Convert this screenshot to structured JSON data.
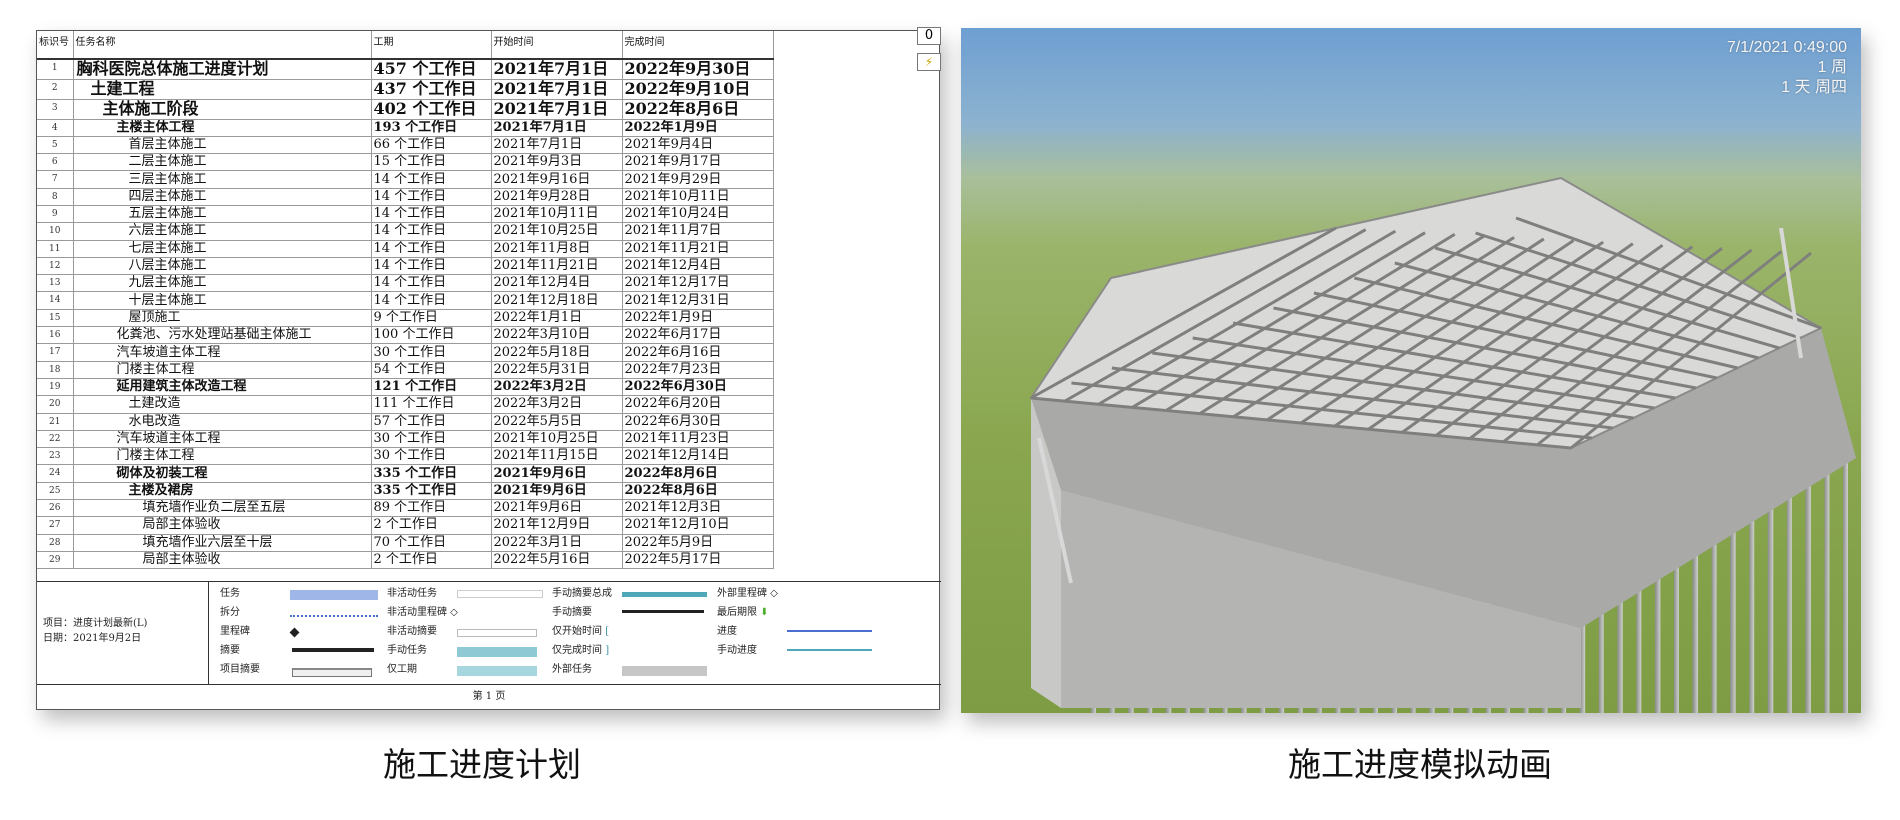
{
  "schedule": {
    "columns": {
      "id": "标识号",
      "name": "任务名称",
      "duration": "工期",
      "start": "开始时间",
      "finish": "完成时间"
    },
    "rows": [
      {
        "id": "1",
        "name": "胸科医院总体施工进度计划",
        "duration": "457 个工作日",
        "start": "2021年7月1日",
        "finish": "2022年9月30日"
      },
      {
        "id": "2",
        "name": "土建工程",
        "duration": "437 个工作日",
        "start": "2021年7月1日",
        "finish": "2022年9月10日"
      },
      {
        "id": "3",
        "name": "主体施工阶段",
        "duration": "402 个工作日",
        "start": "2021年7月1日",
        "finish": "2022年8月6日"
      },
      {
        "id": "4",
        "name": "主楼主体工程",
        "duration": "193 个工作日",
        "start": "2021年7月1日",
        "finish": "2022年1月9日"
      },
      {
        "id": "5",
        "name": "首层主体施工",
        "duration": "66 个工作日",
        "start": "2021年7月1日",
        "finish": "2021年9月4日"
      },
      {
        "id": "6",
        "name": "二层主体施工",
        "duration": "15 个工作日",
        "start": "2021年9月3日",
        "finish": "2021年9月17日"
      },
      {
        "id": "7",
        "name": "三层主体施工",
        "duration": "14 个工作日",
        "start": "2021年9月16日",
        "finish": "2021年9月29日"
      },
      {
        "id": "8",
        "name": "四层主体施工",
        "duration": "14 个工作日",
        "start": "2021年9月28日",
        "finish": "2021年10月11日"
      },
      {
        "id": "9",
        "name": "五层主体施工",
        "duration": "14 个工作日",
        "start": "2021年10月11日",
        "finish": "2021年10月24日"
      },
      {
        "id": "10",
        "name": "六层主体施工",
        "duration": "14 个工作日",
        "start": "2021年10月25日",
        "finish": "2021年11月7日"
      },
      {
        "id": "11",
        "name": "七层主体施工",
        "duration": "14 个工作日",
        "start": "2021年11月8日",
        "finish": "2021年11月21日"
      },
      {
        "id": "12",
        "name": "八层主体施工",
        "duration": "14 个工作日",
        "start": "2021年11月21日",
        "finish": "2021年12月4日"
      },
      {
        "id": "13",
        "name": "九层主体施工",
        "duration": "14 个工作日",
        "start": "2021年12月4日",
        "finish": "2021年12月17日"
      },
      {
        "id": "14",
        "name": "十层主体施工",
        "duration": "14 个工作日",
        "start": "2021年12月18日",
        "finish": "2021年12月31日"
      },
      {
        "id": "15",
        "name": "屋顶施工",
        "duration": "9 个工作日",
        "start": "2022年1月1日",
        "finish": "2022年1月9日"
      },
      {
        "id": "16",
        "name": "化粪池、污水处理站基础主体施工",
        "duration": "100 个工作日",
        "start": "2022年3月10日",
        "finish": "2022年6月17日"
      },
      {
        "id": "17",
        "name": "汽车坡道主体工程",
        "duration": "30 个工作日",
        "start": "2022年5月18日",
        "finish": "2022年6月16日"
      },
      {
        "id": "18",
        "name": "门楼主体工程",
        "duration": "54 个工作日",
        "start": "2022年5月31日",
        "finish": "2022年7月23日"
      },
      {
        "id": "19",
        "name": "延用建筑主体改造工程",
        "duration": "121 个工作日",
        "start": "2022年3月2日",
        "finish": "2022年6月30日"
      },
      {
        "id": "20",
        "name": "土建改造",
        "duration": "111 个工作日",
        "start": "2022年3月2日",
        "finish": "2022年6月20日"
      },
      {
        "id": "21",
        "name": "水电改造",
        "duration": "57 个工作日",
        "start": "2022年5月5日",
        "finish": "2022年6月30日"
      },
      {
        "id": "22",
        "name": "汽车坡道主体工程",
        "duration": "30 个工作日",
        "start": "2021年10月25日",
        "finish": "2021年11月23日"
      },
      {
        "id": "23",
        "name": "门楼主体工程",
        "duration": "30 个工作日",
        "start": "2021年11月15日",
        "finish": "2021年12月14日"
      },
      {
        "id": "24",
        "name": "砌体及初装工程",
        "duration": "335 个工作日",
        "start": "2021年9月6日",
        "finish": "2022年8月6日"
      },
      {
        "id": "25",
        "name": "主楼及裙房",
        "duration": "335 个工作日",
        "start": "2021年9月6日",
        "finish": "2022年8月6日"
      },
      {
        "id": "26",
        "name": "填充墙作业负二层至五层",
        "duration": "89 个工作日",
        "start": "2021年9月6日",
        "finish": "2021年12月3日"
      },
      {
        "id": "27",
        "name": "局部主体验收",
        "duration": "2 个工作日",
        "start": "2021年12月9日",
        "finish": "2021年12月10日"
      },
      {
        "id": "28",
        "name": "填充墙作业六层至十层",
        "duration": "70 个工作日",
        "start": "2022年3月1日",
        "finish": "2022年5月9日"
      },
      {
        "id": "29",
        "name": "局部主体验收",
        "duration": "2 个工作日",
        "start": "2022年5月16日",
        "finish": "2022年5月17日"
      }
    ],
    "corner_number": "0",
    "corner_icon": "⚡"
  },
  "legend": {
    "project": "项目：进度计划最新(L)",
    "date": "日期：2021年9月2日",
    "col1": [
      "任务",
      "拆分",
      "里程碑",
      "摘要",
      "项目摘要"
    ],
    "col2": [
      "非活动任务",
      "非活动里程碑",
      "非活动摘要",
      "手动任务",
      "仅工期"
    ],
    "col3": [
      "手动摘要总成",
      "手动摘要",
      "仅开始时间",
      "仅完成时间",
      "外部任务"
    ],
    "col4": [
      "外部里程碑",
      "最后期限",
      "进度",
      "手动进度"
    ]
  },
  "page_footer": "第 1 页",
  "simulation": {
    "datetime": "7/1/2021 0:49:00",
    "week": "1 周",
    "day": "1 天 周四"
  },
  "captions": {
    "left": "施工进度计划",
    "right": "施工进度模拟动画"
  },
  "colors": {
    "task_bar": "#9fb6e8",
    "manual_task": "#8ec9d4",
    "progress_line": "#4a6fd0",
    "manual_progress": "#4fa8b8",
    "sky": "#6e9fd2",
    "grass": "#8aa74f"
  }
}
